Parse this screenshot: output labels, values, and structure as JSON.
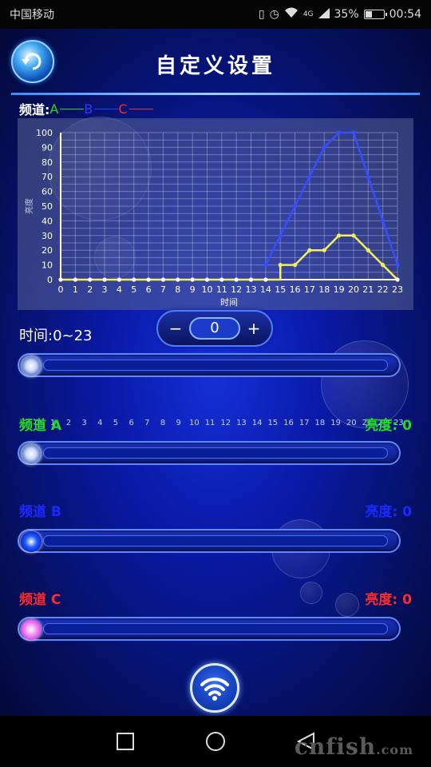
{
  "status_bar": {
    "carrier": "中国移动",
    "network": "4G",
    "battery": "35%",
    "battery_level": 0.35,
    "time": "00:54"
  },
  "header": {
    "title": "自定义设置",
    "back_icon": "back-refresh-icon"
  },
  "legend": {
    "label": "频道:",
    "items": [
      {
        "name": "A",
        "color": "#22dd22"
      },
      {
        "name": "B",
        "color": "#2a3cff"
      },
      {
        "name": "C",
        "color": "#ff2a2a"
      }
    ]
  },
  "chart_data": {
    "type": "line",
    "xlabel": "时间",
    "ylabel": "亮度",
    "x": [
      0,
      1,
      2,
      3,
      4,
      5,
      6,
      7,
      8,
      9,
      10,
      11,
      12,
      13,
      14,
      15,
      16,
      17,
      18,
      19,
      20,
      21,
      22,
      23
    ],
    "xlim": [
      0,
      23
    ],
    "ylim": [
      0,
      100
    ],
    "yticks": [
      0,
      10,
      20,
      30,
      40,
      50,
      60,
      70,
      80,
      90,
      100
    ],
    "grid": true,
    "series": [
      {
        "color": "#3a4cff",
        "values": [
          0,
          0,
          0,
          0,
          0,
          0,
          0,
          0,
          0,
          0,
          0,
          0,
          0,
          0,
          10,
          30,
          50,
          70,
          90,
          100,
          100,
          70,
          40,
          10
        ]
      },
      {
        "color": "#f5f05a",
        "values": [
          0,
          0,
          0,
          0,
          0,
          0,
          0,
          0,
          0,
          0,
          0,
          0,
          0,
          0,
          0,
          10,
          10,
          20,
          20,
          30,
          30,
          20,
          10,
          0
        ]
      }
    ]
  },
  "stepper": {
    "minus": "−",
    "value": "0",
    "plus": "+"
  },
  "time_slider": {
    "label": "时间:0~23",
    "value": 0,
    "ticks": [
      "0",
      "1",
      "2",
      "3",
      "4",
      "5",
      "6",
      "7",
      "8",
      "9",
      "10",
      "11",
      "12",
      "13",
      "14",
      "15",
      "16",
      "17",
      "18",
      "19",
      "20",
      "21",
      "22",
      "23"
    ]
  },
  "channels": [
    {
      "label": "频道 A",
      "brightness_label": "亮度:",
      "brightness": "0",
      "color": "#22dd22"
    },
    {
      "label": "频道 B",
      "brightness_label": "亮度:",
      "brightness": "0",
      "color": "#1a2aff"
    },
    {
      "label": "频道 C",
      "brightness_label": "亮度:",
      "brightness": "0",
      "color": "#ff2a2a"
    }
  ],
  "bottom_button": {
    "icon": "wifi-icon"
  },
  "nav": {
    "recent": "recent-apps-icon",
    "home": "home-icon",
    "back": "back-icon"
  },
  "watermark": {
    "main": "cnfish",
    "suffix": ".com"
  }
}
